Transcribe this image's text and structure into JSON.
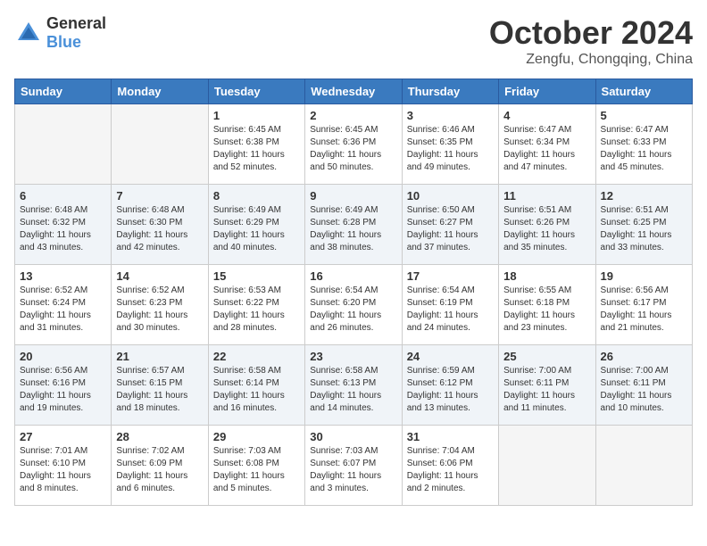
{
  "logo": {
    "general": "General",
    "blue": "Blue"
  },
  "title": "October 2024",
  "location": "Zengfu, Chongqing, China",
  "weekdays": [
    "Sunday",
    "Monday",
    "Tuesday",
    "Wednesday",
    "Thursday",
    "Friday",
    "Saturday"
  ],
  "weeks": [
    [
      {
        "day": "",
        "info": ""
      },
      {
        "day": "",
        "info": ""
      },
      {
        "day": "1",
        "info": "Sunrise: 6:45 AM\nSunset: 6:38 PM\nDaylight: 11 hours and 52 minutes."
      },
      {
        "day": "2",
        "info": "Sunrise: 6:45 AM\nSunset: 6:36 PM\nDaylight: 11 hours and 50 minutes."
      },
      {
        "day": "3",
        "info": "Sunrise: 6:46 AM\nSunset: 6:35 PM\nDaylight: 11 hours and 49 minutes."
      },
      {
        "day": "4",
        "info": "Sunrise: 6:47 AM\nSunset: 6:34 PM\nDaylight: 11 hours and 47 minutes."
      },
      {
        "day": "5",
        "info": "Sunrise: 6:47 AM\nSunset: 6:33 PM\nDaylight: 11 hours and 45 minutes."
      }
    ],
    [
      {
        "day": "6",
        "info": "Sunrise: 6:48 AM\nSunset: 6:32 PM\nDaylight: 11 hours and 43 minutes."
      },
      {
        "day": "7",
        "info": "Sunrise: 6:48 AM\nSunset: 6:30 PM\nDaylight: 11 hours and 42 minutes."
      },
      {
        "day": "8",
        "info": "Sunrise: 6:49 AM\nSunset: 6:29 PM\nDaylight: 11 hours and 40 minutes."
      },
      {
        "day": "9",
        "info": "Sunrise: 6:49 AM\nSunset: 6:28 PM\nDaylight: 11 hours and 38 minutes."
      },
      {
        "day": "10",
        "info": "Sunrise: 6:50 AM\nSunset: 6:27 PM\nDaylight: 11 hours and 37 minutes."
      },
      {
        "day": "11",
        "info": "Sunrise: 6:51 AM\nSunset: 6:26 PM\nDaylight: 11 hours and 35 minutes."
      },
      {
        "day": "12",
        "info": "Sunrise: 6:51 AM\nSunset: 6:25 PM\nDaylight: 11 hours and 33 minutes."
      }
    ],
    [
      {
        "day": "13",
        "info": "Sunrise: 6:52 AM\nSunset: 6:24 PM\nDaylight: 11 hours and 31 minutes."
      },
      {
        "day": "14",
        "info": "Sunrise: 6:52 AM\nSunset: 6:23 PM\nDaylight: 11 hours and 30 minutes."
      },
      {
        "day": "15",
        "info": "Sunrise: 6:53 AM\nSunset: 6:22 PM\nDaylight: 11 hours and 28 minutes."
      },
      {
        "day": "16",
        "info": "Sunrise: 6:54 AM\nSunset: 6:20 PM\nDaylight: 11 hours and 26 minutes."
      },
      {
        "day": "17",
        "info": "Sunrise: 6:54 AM\nSunset: 6:19 PM\nDaylight: 11 hours and 24 minutes."
      },
      {
        "day": "18",
        "info": "Sunrise: 6:55 AM\nSunset: 6:18 PM\nDaylight: 11 hours and 23 minutes."
      },
      {
        "day": "19",
        "info": "Sunrise: 6:56 AM\nSunset: 6:17 PM\nDaylight: 11 hours and 21 minutes."
      }
    ],
    [
      {
        "day": "20",
        "info": "Sunrise: 6:56 AM\nSunset: 6:16 PM\nDaylight: 11 hours and 19 minutes."
      },
      {
        "day": "21",
        "info": "Sunrise: 6:57 AM\nSunset: 6:15 PM\nDaylight: 11 hours and 18 minutes."
      },
      {
        "day": "22",
        "info": "Sunrise: 6:58 AM\nSunset: 6:14 PM\nDaylight: 11 hours and 16 minutes."
      },
      {
        "day": "23",
        "info": "Sunrise: 6:58 AM\nSunset: 6:13 PM\nDaylight: 11 hours and 14 minutes."
      },
      {
        "day": "24",
        "info": "Sunrise: 6:59 AM\nSunset: 6:12 PM\nDaylight: 11 hours and 13 minutes."
      },
      {
        "day": "25",
        "info": "Sunrise: 7:00 AM\nSunset: 6:11 PM\nDaylight: 11 hours and 11 minutes."
      },
      {
        "day": "26",
        "info": "Sunrise: 7:00 AM\nSunset: 6:11 PM\nDaylight: 11 hours and 10 minutes."
      }
    ],
    [
      {
        "day": "27",
        "info": "Sunrise: 7:01 AM\nSunset: 6:10 PM\nDaylight: 11 hours and 8 minutes."
      },
      {
        "day": "28",
        "info": "Sunrise: 7:02 AM\nSunset: 6:09 PM\nDaylight: 11 hours and 6 minutes."
      },
      {
        "day": "29",
        "info": "Sunrise: 7:03 AM\nSunset: 6:08 PM\nDaylight: 11 hours and 5 minutes."
      },
      {
        "day": "30",
        "info": "Sunrise: 7:03 AM\nSunset: 6:07 PM\nDaylight: 11 hours and 3 minutes."
      },
      {
        "day": "31",
        "info": "Sunrise: 7:04 AM\nSunset: 6:06 PM\nDaylight: 11 hours and 2 minutes."
      },
      {
        "day": "",
        "info": ""
      },
      {
        "day": "",
        "info": ""
      }
    ]
  ]
}
